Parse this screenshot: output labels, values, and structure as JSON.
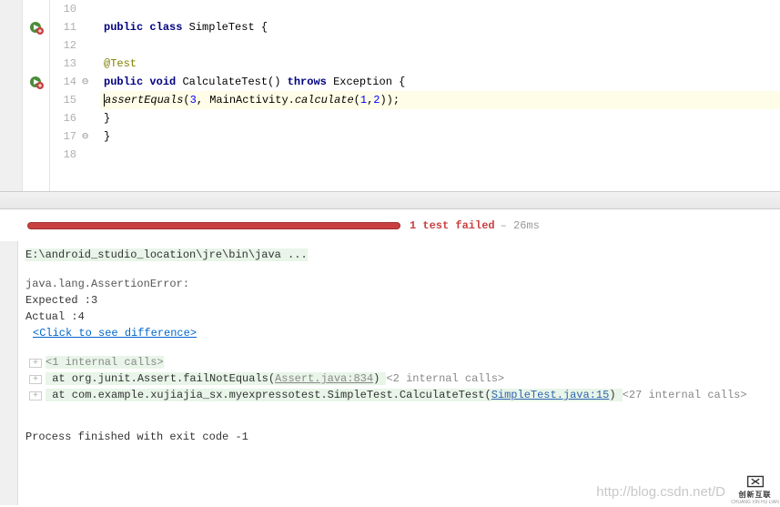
{
  "editor": {
    "lines": [
      {
        "num": "10",
        "bp": "",
        "fold": "",
        "code": ""
      },
      {
        "num": "11",
        "bp": "run",
        "fold": "",
        "code": {
          "segs": [
            {
              "t": "public ",
              "c": "kw"
            },
            {
              "t": "class ",
              "c": "kw"
            },
            {
              "t": "SimpleTest {",
              "c": ""
            }
          ]
        }
      },
      {
        "num": "12",
        "bp": "",
        "fold": "",
        "code": ""
      },
      {
        "num": "13",
        "bp": "",
        "fold": "",
        "code": {
          "indent": "    ",
          "segs": [
            {
              "t": "@Test",
              "c": "ann"
            }
          ]
        }
      },
      {
        "num": "14",
        "bp": "run",
        "fold": "⊖",
        "code": {
          "indent": "    ",
          "segs": [
            {
              "t": "public ",
              "c": "kw"
            },
            {
              "t": "void ",
              "c": "kw"
            },
            {
              "t": "CalculateTest() ",
              "c": ""
            },
            {
              "t": "throws ",
              "c": "kw"
            },
            {
              "t": "Exception {",
              "c": ""
            }
          ]
        }
      },
      {
        "num": "15",
        "bp": "",
        "fold": "",
        "hl": true,
        "code": {
          "indent": "        ",
          "caret": true,
          "segs": [
            {
              "t": "assertEquals",
              "c": "sm"
            },
            {
              "t": "(",
              "c": ""
            },
            {
              "t": "3",
              "c": "num"
            },
            {
              "t": ", MainActivity.",
              "c": ""
            },
            {
              "t": "calculate",
              "c": "sm2"
            },
            {
              "t": "(",
              "c": ""
            },
            {
              "t": "1",
              "c": "num"
            },
            {
              "t": ",",
              "c": ""
            },
            {
              "t": "2",
              "c": "num"
            },
            {
              "t": "));",
              "c": ""
            }
          ]
        }
      },
      {
        "num": "16",
        "bp": "",
        "fold": "",
        "code": {
          "indent": "    ",
          "segs": [
            {
              "t": "}",
              "c": ""
            }
          ]
        }
      },
      {
        "num": "17",
        "bp": "",
        "fold": "⊖",
        "code": {
          "segs": [
            {
              "t": "}",
              "c": ""
            }
          ]
        }
      },
      {
        "num": "18",
        "bp": "",
        "fold": "",
        "code": ""
      }
    ]
  },
  "run": {
    "status_fail": "1 test failed",
    "status_time": "– 26ms"
  },
  "console": {
    "cmd": "E:\\android_studio_location\\jre\\bin\\java ...",
    "err": "java.lang.AssertionError:",
    "expected_lbl": "Expected :",
    "expected_val": "3",
    "actual_lbl": "Actual   :",
    "actual_val": "4",
    "diff": "<Click to see difference>",
    "trace": [
      {
        "exp": true,
        "pre": "",
        "segs": [
          {
            "t": "<1 internal calls>",
            "c": "ic"
          }
        ]
      },
      {
        "exp": true,
        "pre": "    at org.junit.Assert.failNotEquals(",
        "link": "Assert.java:834",
        "lc": "tlink",
        "post": ") ",
        "tail": "<2 internal calls>"
      },
      {
        "exp": true,
        "pre": "    at com.example.xujiajia_sx.myexpressotest.SimpleTest.CalculateTest(",
        "link": "SimpleTest.java:15",
        "lc": "tlink2",
        "post": ") ",
        "tail": "<27 internal calls>"
      }
    ],
    "exit": "Process finished with exit code -1"
  },
  "watermark": "http://blog.csdn.net/D",
  "logo": {
    "t": "创新互联",
    "s": "CHUANG XIN HU LIAN"
  }
}
